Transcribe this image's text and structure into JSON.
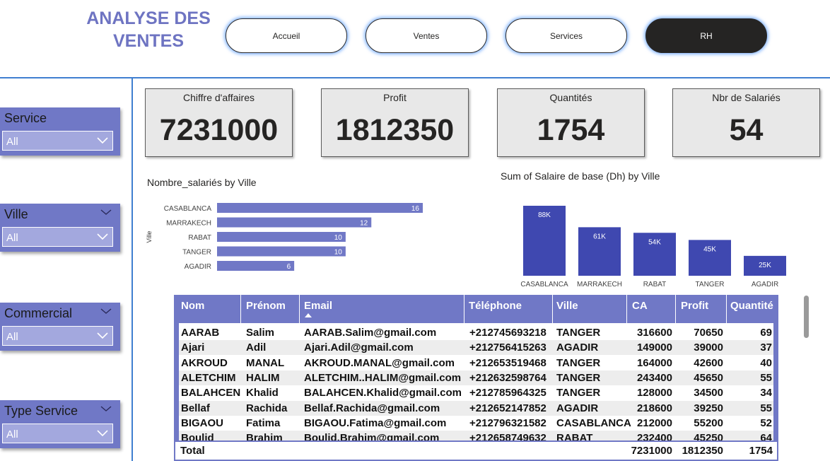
{
  "header": {
    "title": "ANALYSE DES VENTES",
    "nav": [
      {
        "label": "Accueil",
        "active": false
      },
      {
        "label": "Ventes",
        "active": false
      },
      {
        "label": "Services",
        "active": false
      },
      {
        "label": "RH",
        "active": true
      }
    ]
  },
  "slicers": [
    {
      "label": "Service",
      "value": "All"
    },
    {
      "label": "Ville",
      "value": "All"
    },
    {
      "label": "Commercial",
      "value": "All"
    },
    {
      "label": "Type Service",
      "value": "All"
    }
  ],
  "kpis": [
    {
      "title": "Chiffre d'affaires",
      "value": "7231000"
    },
    {
      "title": "Profit",
      "value": "1812350"
    },
    {
      "title": "Quantités",
      "value": "1754"
    },
    {
      "title": "Nbr de Salariés",
      "value": "54"
    }
  ],
  "colors": {
    "accent": "#7078c6",
    "bar_column": "#3f48b0",
    "nav_glow": "#60a0ff"
  },
  "chart_data": [
    {
      "type": "bar",
      "orientation": "horizontal",
      "title": "Nombre_salariés by Ville",
      "ylabel": "Ville",
      "xlabel": "",
      "categories": [
        "CASABLANCA",
        "MARRAKECH",
        "RABAT",
        "TANGER",
        "AGADIR"
      ],
      "values": [
        16,
        12,
        10,
        10,
        6
      ],
      "data_labels": [
        "16",
        "12",
        "10",
        "10",
        "6"
      ],
      "xlim": [
        0,
        16
      ]
    },
    {
      "type": "bar",
      "orientation": "vertical",
      "title": "Sum of Salaire de base (Dh) by Ville",
      "xlabel": "",
      "ylabel": "",
      "categories": [
        "CASABLANCA",
        "MARRAKECH",
        "RABAT",
        "TANGER",
        "AGADIR"
      ],
      "values": [
        88000,
        61000,
        54000,
        45000,
        25000
      ],
      "data_labels": [
        "88K",
        "61K",
        "54K",
        "45K",
        "25K"
      ],
      "ylim": [
        0,
        88000
      ]
    }
  ],
  "table": {
    "columns": [
      "Nom",
      "Prénom",
      "Email",
      "Téléphone",
      "Ville",
      "CA",
      "Profit",
      "Quantité"
    ],
    "sort_column": "Email",
    "rows": [
      [
        "AARAB",
        "Salim",
        "AARAB.Salim@gmail.com",
        "+212745693218",
        "TANGER",
        "316600",
        "70650",
        "69"
      ],
      [
        "Ajari",
        "Adil",
        "Ajari.Adil@gmail.com",
        "+212756415263",
        "AGADIR",
        "149000",
        "39000",
        "37"
      ],
      [
        "AKROUD",
        "MANAL",
        "AKROUD.MANAL@gmail.com",
        "+212653519468",
        "TANGER",
        "164000",
        "42600",
        "40"
      ],
      [
        "ALETCHIM",
        "HALIM",
        "ALETCHIM..HALIM@gmail.com",
        "+212632598764",
        "TANGER",
        "243400",
        "45650",
        "55"
      ],
      [
        "BALAHCEN",
        "Khalid",
        "BALAHCEN.Khalid@gmail.com",
        "+212785964325",
        "TANGER",
        "128000",
        "34500",
        "34"
      ],
      [
        "Bellaf",
        "Rachida",
        "Bellaf.Rachida@gmail.com",
        "+212652147852",
        "AGADIR",
        "218600",
        "39250",
        "55"
      ],
      [
        "BIGAOU",
        "Fatima",
        "BIGAOU.Fatima@gmail.com",
        "+212796321582",
        "CASABLANCA",
        "212000",
        "55200",
        "52"
      ],
      [
        "Boulid",
        "Brahim",
        "Boulid.Brahim@gmail.com",
        "+212658749632",
        "RABAT",
        "232400",
        "45250",
        "64"
      ]
    ],
    "total": {
      "label": "Total",
      "ca": "7231000",
      "profit": "1812350",
      "quantite": "1754"
    }
  }
}
